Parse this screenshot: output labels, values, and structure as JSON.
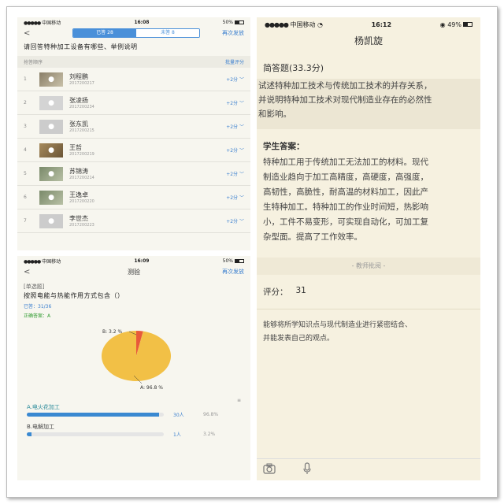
{
  "panel1": {
    "status": {
      "carrier": "中国移动",
      "wifi": "wifi-icon",
      "time": "16:08",
      "battery": "50%"
    },
    "nav": {
      "back": "<",
      "tab_answered": "已答 28",
      "tab_unanswered": "未答 8",
      "resend": "再次发放"
    },
    "question": "请回答特种加工设备有哪些、举例说明",
    "list_header": {
      "left": "抢答顺序",
      "right": "批量评分"
    },
    "rows": [
      {
        "no": "1",
        "name": "刘程鹏",
        "id": "2017200217",
        "score": "+2分"
      },
      {
        "no": "2",
        "name": "张凌扬",
        "id": "2017200234",
        "score": "+2分"
      },
      {
        "no": "3",
        "name": "张东凯",
        "id": "2017200215",
        "score": "+2分"
      },
      {
        "no": "4",
        "name": "王哲",
        "id": "2017200219",
        "score": "+2分"
      },
      {
        "no": "5",
        "name": "苏锦涛",
        "id": "2017200214",
        "score": "+2分"
      },
      {
        "no": "6",
        "name": "王逸卓",
        "id": "2017200220",
        "score": "+2分"
      },
      {
        "no": "7",
        "name": "李世杰",
        "id": "2017200223",
        "score": "+2分"
      }
    ]
  },
  "panel2": {
    "status": {
      "carrier": "中国移动",
      "wifi": "wifi-icon",
      "time": "16:09",
      "battery": "50%"
    },
    "nav": {
      "back": "<",
      "title": "测验",
      "resend": "再次发放"
    },
    "tag": "[单选题]",
    "question": "按照电能与热能作用方式包含（）",
    "answered": "已答：31/36",
    "correct": "正确答案：A",
    "pie_labels": {
      "a": "A: 96.8 %",
      "b": "B: 3.2 %"
    },
    "lock_icon": "≡",
    "options": [
      {
        "label": "A.电火花加工",
        "count": "30人",
        "pct": "96.8%",
        "value": 0.968
      },
      {
        "label": "B.电解加工",
        "count": "1人",
        "pct": "3.2%",
        "value": 0.032
      }
    ],
    "colors": {
      "slice_a": "#f2c046",
      "slice_b": "#e8593a",
      "bar": "#3a89d1"
    }
  },
  "panel3": {
    "status": {
      "carrier": "中国移动",
      "wifi": "wifi-icon",
      "time": "16:12",
      "battery": "49%"
    },
    "student": "杨凯旋",
    "section": "简答题(33.3分)",
    "question_lines": [
      "试述特种加工技术与传统加工技术的并存关系，",
      "并说明特种加工技术对现代制造业存在的必然性",
      "和影响。"
    ],
    "answer_label": "学生答案：",
    "answer_lines": [
      "特种加工用于传统加工无法加工的材料。现代",
      "制造业趋向于加工高精度，高硬度，高强度，",
      "高韧性，高脆性，耐高温的材料加工，因此产",
      "生特种加工。特种加工的作业时间短，热影响",
      "小，工件不易变形，可实现自动化，可加工复",
      "杂型面。提高了工作效率。"
    ],
    "teacher_divider": "- 教师批阅 -",
    "score_label": "评分：",
    "score_value": "31",
    "comment_lines": [
      "能够将所学知识点与现代制造业进行紧密结合、",
      "并能发表自己的观点。"
    ],
    "bottom_icons": [
      "camera-icon",
      "microphone-icon"
    ]
  }
}
